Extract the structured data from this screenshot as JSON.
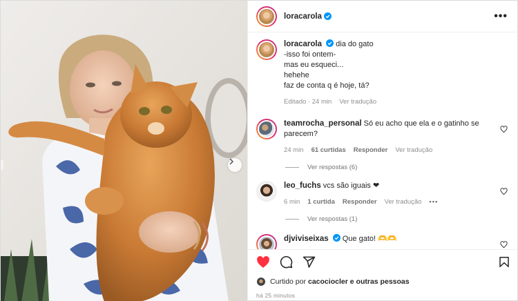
{
  "header": {
    "username": "loracarola",
    "more_label": "•••"
  },
  "caption": {
    "username": "loracarola",
    "first_line": "dia do gato",
    "lines": "-isso foi ontem-\nmas eu esqueci...\nhehehe\nfaz de conta q é hoje, tá?",
    "edited": "Editado",
    "time": "24 min",
    "translate": "Ver tradução"
  },
  "comments": [
    {
      "username": "teamrocha_personal",
      "text": "Só eu acho que ela e o gatinho se parecem?",
      "time": "24 min",
      "likes": "61 curtidas",
      "reply": "Responder",
      "translate": "Ver tradução",
      "replies": "Ver respostas (6)"
    },
    {
      "username": "leo_fuchs",
      "text": "vcs são iguais ❤",
      "time": "6 min",
      "likes": "1 curtida",
      "reply": "Responder",
      "translate": "Ver tradução",
      "more": "•••",
      "replies": "Ver respostas (1)"
    },
    {
      "username": "djviviseixas",
      "text": "Que gato! 🫶🫶"
    }
  ],
  "likes": {
    "prefix": "Curtido por",
    "user": "cacociocler",
    "suffix": "e outras pessoas"
  },
  "posted_time": "há 25 minutos",
  "colors": {
    "like_red": "#ff3040",
    "verified_blue": "#0095f6",
    "meta_gray": "#8e8e8e"
  },
  "icons": [
    "heart-icon",
    "comment-icon",
    "share-icon",
    "save-icon",
    "verified-icon",
    "chevron-right-icon"
  ]
}
